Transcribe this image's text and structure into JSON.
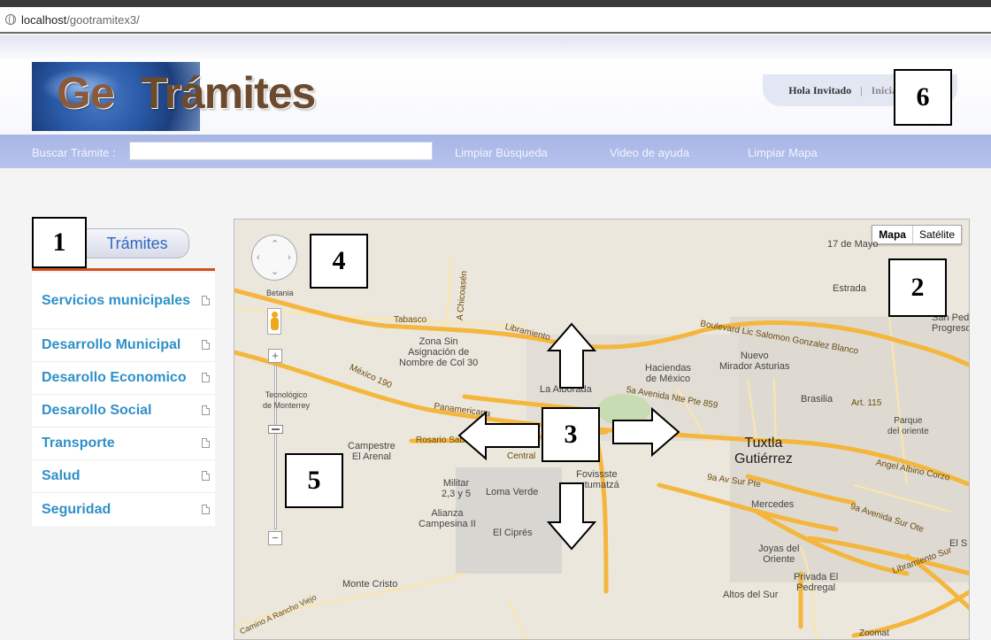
{
  "browser": {
    "url_host": "localhost",
    "url_path": "/gootramitex3/"
  },
  "logo": {
    "part1": "Ge",
    "part2": "Trámites"
  },
  "user": {
    "greeting": "Hola Invitado",
    "separator": "|",
    "login": "Iniciar sesión"
  },
  "search": {
    "label": "Buscar Trámite :",
    "value": "",
    "links": [
      "Limpiar Búsqueda",
      "Video de ayuda",
      "Limpiar Mapa"
    ]
  },
  "menu": {
    "button": "Trámites",
    "items": [
      "Servicios municipales",
      "Desarrollo Municipal",
      "Desarollo Economico",
      "Desarollo Social",
      "Transporte",
      "Salud",
      "Seguridad"
    ]
  },
  "map": {
    "type_controls": [
      "Mapa",
      "Satélite"
    ],
    "zoom_plus": "+",
    "zoom_minus": "−",
    "labels": {
      "betania": "Betania",
      "tabasco": "Tabasco",
      "chicoasen": "A Chicoasén",
      "libramiento": "Libramiento",
      "zona_sin": "Zona Sin\nAsignación de\nNombre de Col 30",
      "la_alborada": "La Alborada",
      "haciendas": "Haciendas\nde México",
      "nuevo_mirador": "Nuevo\nMirador Asturias",
      "boulevard": "Boulevard Lic Salomon Gonzalez Blanco",
      "estrada": "Estrada",
      "17_de_mayo": "17 de Mayo",
      "san_pedro": "San Pedro\nProgreso",
      "tecnologico": "Tecnológico\nde Monterrey",
      "mexico_190": "México 190",
      "panamericana": "Panamericana",
      "avenida_nte": "5a Avenida Nte Pte 859",
      "brasilia": "Brasilia",
      "art115": "Art. 115",
      "parque": "Parque\ndel oriente",
      "campestre": "Campestre\nEl Arenal",
      "rosario": "Rosario Sabines",
      "central": "Central",
      "tuxtla": "Tuxtla\nGutiérrez",
      "militar": "Militar\n2,3 y 5",
      "loma_verde": "Loma Verde",
      "fovissste": "Fovissste\nactumatzá",
      "alianza": "Alianza\nCampesina II",
      "el_cipres": "El Ciprés",
      "9a_av_sur": "9a Av Sur Pte",
      "mercedes": "Mercedes",
      "angel_albino": "Angel Albino Corzo",
      "9a_avenida_sur": "9a Avenida Sur Ote",
      "joyas": "Joyas del\nOriente",
      "privada": "Privada El\nPedregal",
      "altos_sur": "Altos del Sur",
      "monte_cristo": "Monte Cristo",
      "rancho_viejo": "Camino A Rancho Viejo",
      "zoomat": "Zoomat",
      "libramiento_sur": "Libramiento Sur",
      "el_s": "El S"
    }
  },
  "annotations": [
    "1",
    "2",
    "3",
    "4",
    "5",
    "6"
  ],
  "colors": {
    "menu_text": "#2f90c8",
    "menu_rule": "#d25020",
    "searchbar": "#aebbe9",
    "road": "#f4b63c"
  }
}
